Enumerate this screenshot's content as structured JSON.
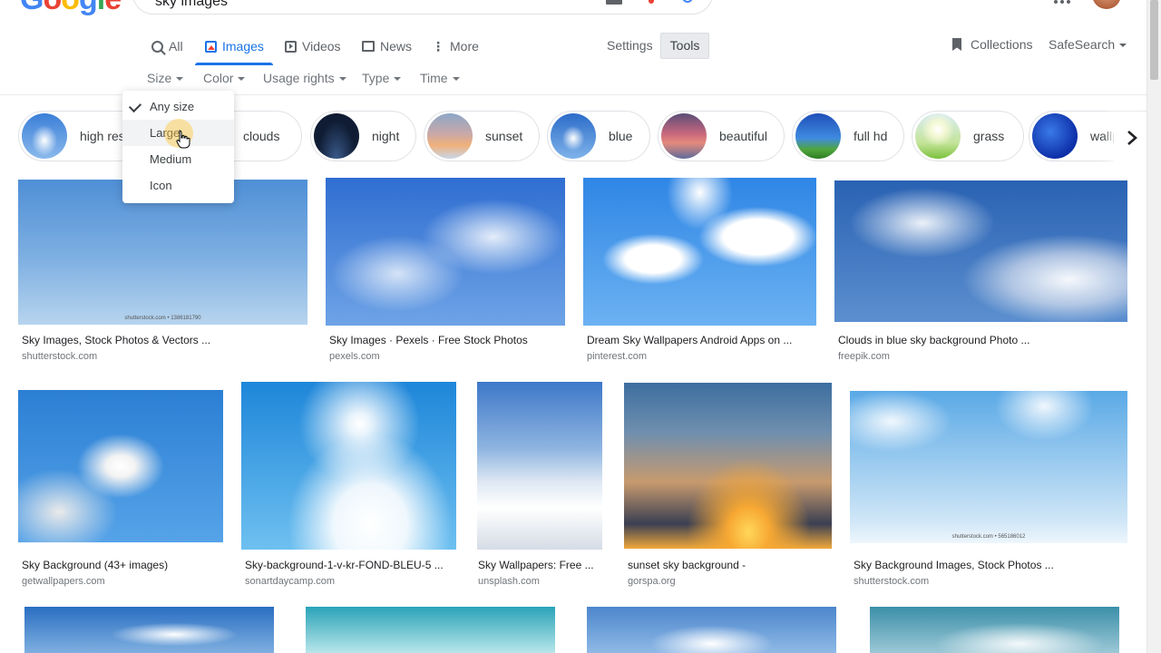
{
  "header": {
    "logo": [
      "G",
      "o",
      "o",
      "g",
      "l",
      "e"
    ],
    "query": "sky images",
    "icons": [
      "keyboard-icon",
      "microphone-icon",
      "lens-icon",
      "apps-icon"
    ]
  },
  "nav": {
    "tabs": [
      {
        "label": "All",
        "icon": "search-icon"
      },
      {
        "label": "Images",
        "icon": "image-icon",
        "active": true
      },
      {
        "label": "Videos",
        "icon": "video-icon"
      },
      {
        "label": "News",
        "icon": "news-icon"
      },
      {
        "label": "More",
        "icon": "more-vert-icon"
      }
    ],
    "settings": "Settings",
    "tools": "Tools",
    "collections": "Collections",
    "safesearch": "SafeSearch"
  },
  "tools_row": [
    "Size",
    "Color",
    "Usage rights",
    "Type",
    "Time"
  ],
  "size_menu": {
    "items": [
      "Any size",
      "Large",
      "Medium",
      "Icon"
    ],
    "selected": "Any size",
    "hovered": "Large"
  },
  "chips": [
    "high res",
    "clouds",
    "night",
    "sunset",
    "blue",
    "beautiful",
    "full hd",
    "grass",
    "wallp"
  ],
  "results": [
    {
      "title": "Sky Images, Stock Photos & Vectors ...",
      "source": "shutterstock.com",
      "watermark": "shutterstock.com • 1386181790"
    },
    {
      "title": "Sky Images · Pexels · Free Stock Photos",
      "source": "pexels.com"
    },
    {
      "title": "Dream Sky Wallpapers Android Apps on ...",
      "source": "pinterest.com"
    },
    {
      "title": "Clouds in blue sky background Photo ...",
      "source": "freepik.com"
    },
    {
      "title": "Sky Background (43+ images)",
      "source": "getwallpapers.com"
    },
    {
      "title": "Sky-background-1-v-kr-FOND-BLEU-5 ...",
      "source": "sonartdaycamp.com"
    },
    {
      "title": "Sky Wallpapers: Free ...",
      "source": "unsplash.com"
    },
    {
      "title": "sunset sky background -",
      "source": "gorspa.org"
    },
    {
      "title": "Sky Background Images, Stock Photos ...",
      "source": "shutterstock.com",
      "watermark": "shutterstock.com • 565186012"
    }
  ],
  "colors": {
    "accent": "#1a73e8",
    "text": "#202124",
    "muted": "#70757a"
  }
}
